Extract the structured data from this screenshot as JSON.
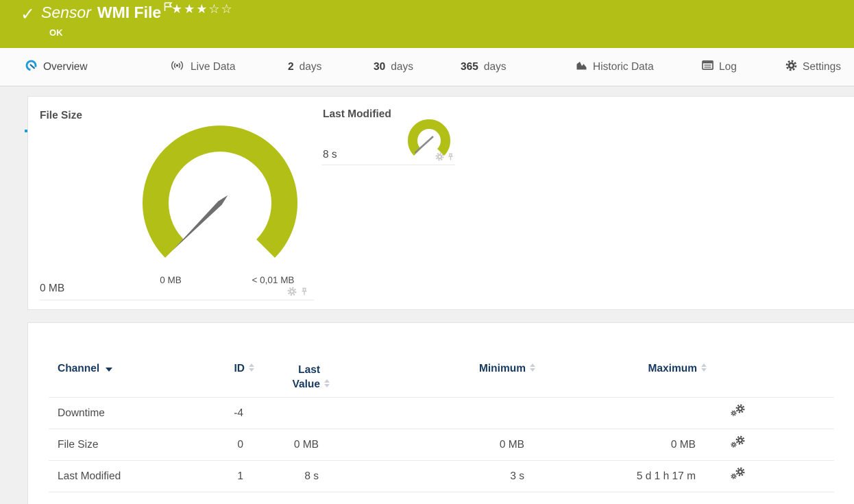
{
  "colors": {
    "status_green": "#b1bf17",
    "accent_blue": "#1e9cd7",
    "table_header_navy": "#17395f"
  },
  "header": {
    "status_icon": "check-icon",
    "sensor_kind": "Sensor",
    "sensor_name": "WMI File",
    "flag_icon": "flag-icon",
    "rating_filled": "★★★",
    "rating_empty": "☆☆",
    "status_text": "OK"
  },
  "tabs": {
    "overview": "Overview",
    "live_data": "Live Data",
    "d2_num": "2",
    "d2_unit": "days",
    "d30_num": "30",
    "d30_unit": "days",
    "d365_num": "365",
    "d365_unit": "days",
    "historic": "Historic Data",
    "log": "Log",
    "settings": "Settings",
    "active_tab": "Overview"
  },
  "gauges": {
    "primary": {
      "title": "File Size",
      "value": "0 MB",
      "scale_min": "0 MB",
      "scale_max": "< 0,01 MB",
      "icons": [
        "gear-icon",
        "pin-icon"
      ]
    },
    "secondary": {
      "title": "Last Modified",
      "value": "8 s",
      "icons": [
        "gear-icon",
        "pin-icon"
      ]
    }
  },
  "channel_table": {
    "headers": {
      "channel": "Channel",
      "id": "ID",
      "last_value": "Last Value",
      "minimum": "Minimum",
      "maximum": "Maximum"
    },
    "sorted_by": "Channel",
    "rows": [
      {
        "channel": "Downtime",
        "id": "-4",
        "last_value": "",
        "minimum": "",
        "maximum": ""
      },
      {
        "channel": "File Size",
        "id": "0",
        "last_value": "0 MB",
        "minimum": "0 MB",
        "maximum": "0 MB"
      },
      {
        "channel": "Last Modified",
        "id": "1",
        "last_value": "8 s",
        "minimum": "3 s",
        "maximum": "5 d 1 h 17 m"
      }
    ]
  }
}
